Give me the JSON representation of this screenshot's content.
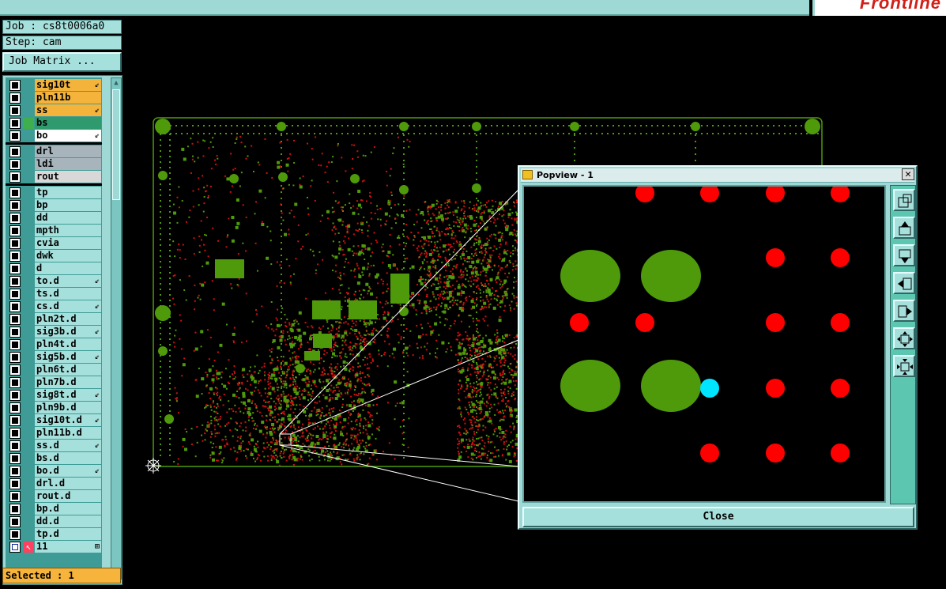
{
  "header": {
    "logo_text": "Frontline"
  },
  "job": {
    "job_label": "Job : cs8t0006a0",
    "step_label": "Step: cam",
    "matrix_button": "Job Matrix ..."
  },
  "layers": [
    {
      "name": "sig10t",
      "color": "#f4b43c",
      "flag": "⇙",
      "group": 1
    },
    {
      "name": "pln11b",
      "color": "#f4b43c",
      "flag": "",
      "group": 1
    },
    {
      "name": "ss",
      "color": "#f4b43c",
      "flag": "⇙",
      "group": 1
    },
    {
      "name": "bs",
      "color": "#2f9a6e",
      "flag": "",
      "group": 1,
      "active": true
    },
    {
      "name": "bo",
      "color": "#ffffff",
      "flag": "⇙",
      "group": 1
    },
    {
      "name": "drl",
      "color": "#a8b4bc",
      "flag": "",
      "group": 2
    },
    {
      "name": "ldi",
      "color": "#a8b4bc",
      "flag": "",
      "group": 2
    },
    {
      "name": "rout",
      "color": "#d8d8d8",
      "flag": "",
      "group": 2
    },
    {
      "name": "tp",
      "color": "#a6e0dc",
      "flag": "",
      "group": 3
    },
    {
      "name": "bp",
      "color": "#a6e0dc",
      "flag": "",
      "group": 3
    },
    {
      "name": "dd",
      "color": "#a6e0dc",
      "flag": "",
      "group": 3
    },
    {
      "name": "mpth",
      "color": "#a6e0dc",
      "flag": "",
      "group": 3
    },
    {
      "name": "cvia",
      "color": "#a6e0dc",
      "flag": "",
      "group": 3
    },
    {
      "name": "dwk",
      "color": "#a6e0dc",
      "flag": "",
      "group": 3
    },
    {
      "name": "d",
      "color": "#a6e0dc",
      "flag": "",
      "group": 3
    },
    {
      "name": "to.d",
      "color": "#a6e0dc",
      "flag": "⇙",
      "group": 3
    },
    {
      "name": "ts.d",
      "color": "#a6e0dc",
      "flag": "",
      "group": 3
    },
    {
      "name": "cs.d",
      "color": "#a6e0dc",
      "flag": "⇙",
      "group": 3
    },
    {
      "name": "pln2t.d",
      "color": "#a6e0dc",
      "flag": "",
      "group": 3
    },
    {
      "name": "sig3b.d",
      "color": "#a6e0dc",
      "flag": "⇙",
      "group": 3
    },
    {
      "name": "pln4t.d",
      "color": "#a6e0dc",
      "flag": "",
      "group": 3
    },
    {
      "name": "sig5b.d",
      "color": "#a6e0dc",
      "flag": "⇙",
      "group": 3
    },
    {
      "name": "pln6t.d",
      "color": "#a6e0dc",
      "flag": "",
      "group": 3
    },
    {
      "name": "pln7b.d",
      "color": "#a6e0dc",
      "flag": "",
      "group": 3
    },
    {
      "name": "sig8t.d",
      "color": "#a6e0dc",
      "flag": "⇙",
      "group": 3
    },
    {
      "name": "pln9b.d",
      "color": "#a6e0dc",
      "flag": "",
      "group": 3
    },
    {
      "name": "sig10t.d",
      "color": "#a6e0dc",
      "flag": "⇙",
      "group": 3
    },
    {
      "name": "pln11b.d",
      "color": "#a6e0dc",
      "flag": "",
      "group": 3
    },
    {
      "name": "ss.d",
      "color": "#a6e0dc",
      "flag": "⇙",
      "group": 3
    },
    {
      "name": "bs.d",
      "color": "#a6e0dc",
      "flag": "",
      "group": 3
    },
    {
      "name": "bo.d",
      "color": "#a6e0dc",
      "flag": "⇙",
      "group": 3
    },
    {
      "name": "drl.d",
      "color": "#a6e0dc",
      "flag": "",
      "group": 3
    },
    {
      "name": "rout.d",
      "color": "#a6e0dc",
      "flag": "",
      "group": 3
    },
    {
      "name": "bp.d",
      "color": "#a6e0dc",
      "flag": "",
      "group": 3
    },
    {
      "name": "dd.d",
      "color": "#a6e0dc",
      "flag": "",
      "group": 3
    },
    {
      "name": "tp.d",
      "color": "#a6e0dc",
      "flag": "",
      "group": 3
    },
    {
      "name": "11",
      "color": "#a6e0dc",
      "flag": "⊞",
      "group": 3,
      "special": true
    }
  ],
  "status": {
    "selected_label": "Selected : 1"
  },
  "popup": {
    "title": "Popview - 1",
    "close_x": "✕",
    "close_button": "Close",
    "tools": [
      "zoom-fit-icon",
      "pan-up-icon",
      "pan-down-icon",
      "pan-left-icon",
      "pan-right-icon",
      "zoom-out-icon",
      "zoom-in-icon"
    ]
  },
  "colors": {
    "panel": "#9ed9d5",
    "copper": "#4f9a0a",
    "drill": "#ff0000",
    "highlight": "#00e5ff",
    "selected_bg": "#f6b43c"
  }
}
